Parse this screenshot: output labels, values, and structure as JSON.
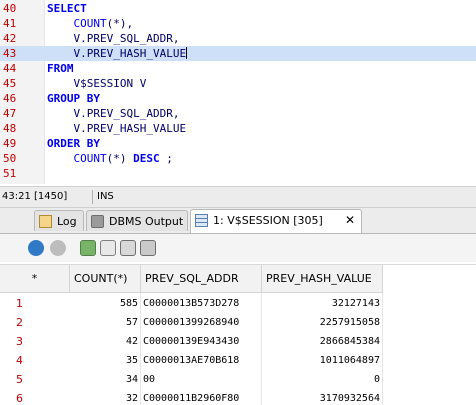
{
  "editor": {
    "lines": [
      {
        "num": "40",
        "code": [
          {
            "t": "SELECT",
            "c": "kw"
          }
        ]
      },
      {
        "num": "41",
        "code": [
          {
            "t": "    "
          },
          {
            "t": "COUNT",
            "c": "fn"
          },
          {
            "t": "(*),"
          }
        ]
      },
      {
        "num": "42",
        "code": [
          {
            "t": "    V.PREV_SQL_ADDR,"
          }
        ]
      },
      {
        "num": "43",
        "code": [
          {
            "t": "    V.PREV_HASH_VALUE"
          }
        ],
        "highlight": true
      },
      {
        "num": "44",
        "code": [
          {
            "t": "FROM",
            "c": "kw"
          }
        ]
      },
      {
        "num": "45",
        "code": [
          {
            "t": "    V$SESSION V"
          }
        ]
      },
      {
        "num": "46",
        "code": [
          {
            "t": "GROUP BY",
            "c": "kw"
          }
        ]
      },
      {
        "num": "47",
        "code": [
          {
            "t": "    V.PREV_SQL_ADDR,"
          }
        ]
      },
      {
        "num": "48",
        "code": [
          {
            "t": "    V.PREV_HASH_VALUE"
          }
        ]
      },
      {
        "num": "49",
        "code": [
          {
            "t": "ORDER BY",
            "c": "kw"
          }
        ]
      },
      {
        "num": "50",
        "code": [
          {
            "t": "    "
          },
          {
            "t": "COUNT",
            "c": "fn"
          },
          {
            "t": "(*) "
          },
          {
            "t": "DESC",
            "c": "kw"
          },
          {
            "t": " ;"
          }
        ]
      },
      {
        "num": "51",
        "code": []
      }
    ]
  },
  "status": {
    "position": "43:21 [1450]",
    "mode": "INS"
  },
  "tabs": [
    {
      "label": "Log",
      "icon": "log-icon"
    },
    {
      "label": "DBMS Output",
      "icon": "dbms-output-icon"
    },
    {
      "label": "1: V$SESSION [305]",
      "icon": "grid-icon",
      "close": "✕",
      "active": true
    }
  ],
  "toolbar": {
    "icons": [
      "refresh-icon",
      "stop-icon",
      "export-icon",
      "copy-icon",
      "print-icon",
      "filter-icon"
    ]
  },
  "grid": {
    "corner": "*",
    "columns": [
      "COUNT(*)",
      "PREV_SQL_ADDR",
      "PREV_HASH_VALUE"
    ],
    "rows": [
      {
        "n": "1",
        "count": "585",
        "addr": "C0000013B573D278",
        "hash": "32127143"
      },
      {
        "n": "2",
        "count": "57",
        "addr": "C000001399268940",
        "hash": "2257915058"
      },
      {
        "n": "3",
        "count": "42",
        "addr": "C00000139E943430",
        "hash": "2866845384"
      },
      {
        "n": "4",
        "count": "35",
        "addr": "C0000013AE70B618",
        "hash": "1011064897"
      },
      {
        "n": "5",
        "count": "34",
        "addr": "00",
        "hash": "0"
      },
      {
        "n": "6",
        "count": "32",
        "addr": "C0000011B2960F80",
        "hash": "3170932564"
      }
    ]
  }
}
